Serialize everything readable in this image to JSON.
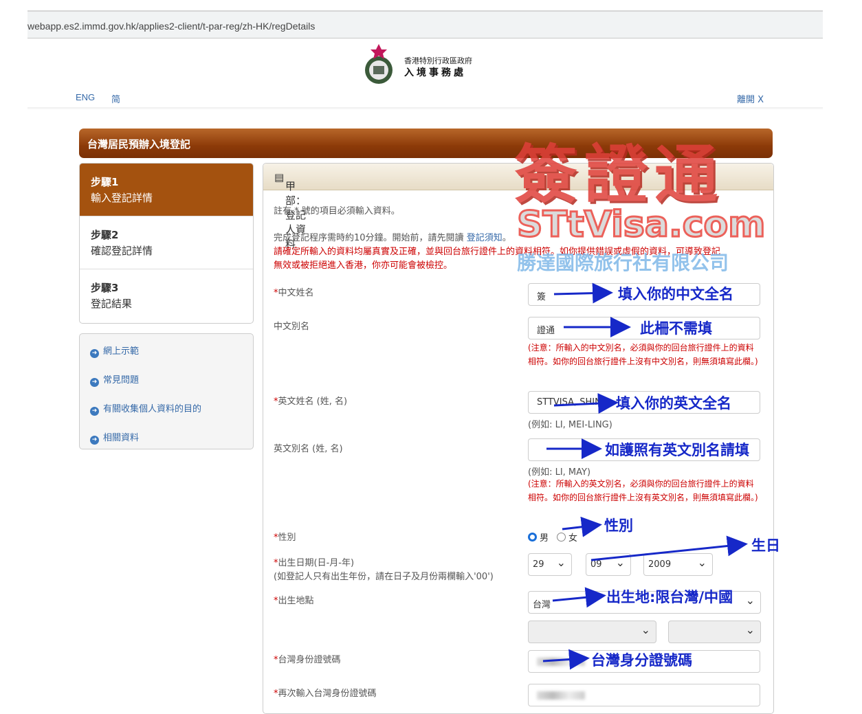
{
  "browser": {
    "url": "webapp.es2.immd.gov.hk/applies2-client/t-par-reg/zh-HK/regDetails"
  },
  "header": {
    "dept_line1": "香港特別行政區政府",
    "dept_line2": "入境事務處",
    "lang_eng": "ENG",
    "lang_sc": "简",
    "exit": "離開 X"
  },
  "banner": {
    "title": "台灣居民預辦入境登記"
  },
  "steps": [
    {
      "num": "步驟1",
      "label": "輸入登記詳情",
      "active": true
    },
    {
      "num": "步驟2",
      "label": "確認登記詳情",
      "active": false
    },
    {
      "num": "步驟3",
      "label": "登記結果",
      "active": false
    }
  ],
  "links": [
    "網上示範",
    "常見問題",
    "有關收集個人資料的目的",
    "相關資料"
  ],
  "panel": {
    "title": "甲部：登記人資料",
    "required_note": "註有 * 號的項目必須輸入資料。",
    "intro_black": "完成登記程序需時約10分鐘。開始前，請先閱讀",
    "intro_link": "登記須知",
    "intro_end": "。",
    "warning_line1": "請確定所輸入的資料均屬真實及正確，並與回台旅行證件上的資料相符。如你提供錯誤或虛假的資料，可導致登記",
    "warning_line2": "無效或被拒絕進入香港，你亦可能會被檢控。"
  },
  "form": {
    "chinese_name": {
      "label": "中文姓名",
      "value": "簽"
    },
    "chinese_alias": {
      "label": "中文別名",
      "value": "證通",
      "note": "(注意：所輸入的中文別名，必須與你的回台旅行證件上的資料相符。如你的回台旅行證件上沒有中文別名，則無須填寫此欄。)"
    },
    "english_name": {
      "label": "英文姓名 (姓, 名)",
      "value": "STTVISA, SHING-",
      "example": "(例如: LI, MEI-LING)"
    },
    "english_alias": {
      "label": "英文別名 (姓, 名)",
      "value": "",
      "example": "(例如: LI, MAY)",
      "note": "(注意：所輸入的英文別名，必須與你的回台旅行證件上的資料相符。如你的回台旅行證件上沒有英文別名，則無須填寫此欄。)"
    },
    "gender": {
      "label": "性別",
      "male": "男",
      "female": "女",
      "selected": "male"
    },
    "dob": {
      "label": "出生日期(日-月-年)",
      "sub": "(如登記人只有出生年份，請在日子及月份兩欄輸入'00')",
      "day": "29",
      "month": "09",
      "year": "2009"
    },
    "birthplace": {
      "label": "出生地點",
      "value": "台灣"
    },
    "tw_id": {
      "label": "台灣身份證號碼"
    },
    "tw_id_confirm": {
      "label": "再次輸入台灣身份證號碼"
    }
  },
  "annotations": {
    "chinese_name": "填入你的中文全名",
    "chinese_alias": "此柵不需填",
    "english_name": "填入你的英文全名",
    "english_alias": "如護照有英文別名請填",
    "gender": "性別",
    "dob": "生日",
    "birthplace": "出生地:限台灣/中國",
    "tw_id": "台灣身分證號碼"
  },
  "watermark": {
    "line1": "簽證通",
    "line2": "STtVisa.com",
    "line3": "勝達國際旅行社有限公司"
  }
}
